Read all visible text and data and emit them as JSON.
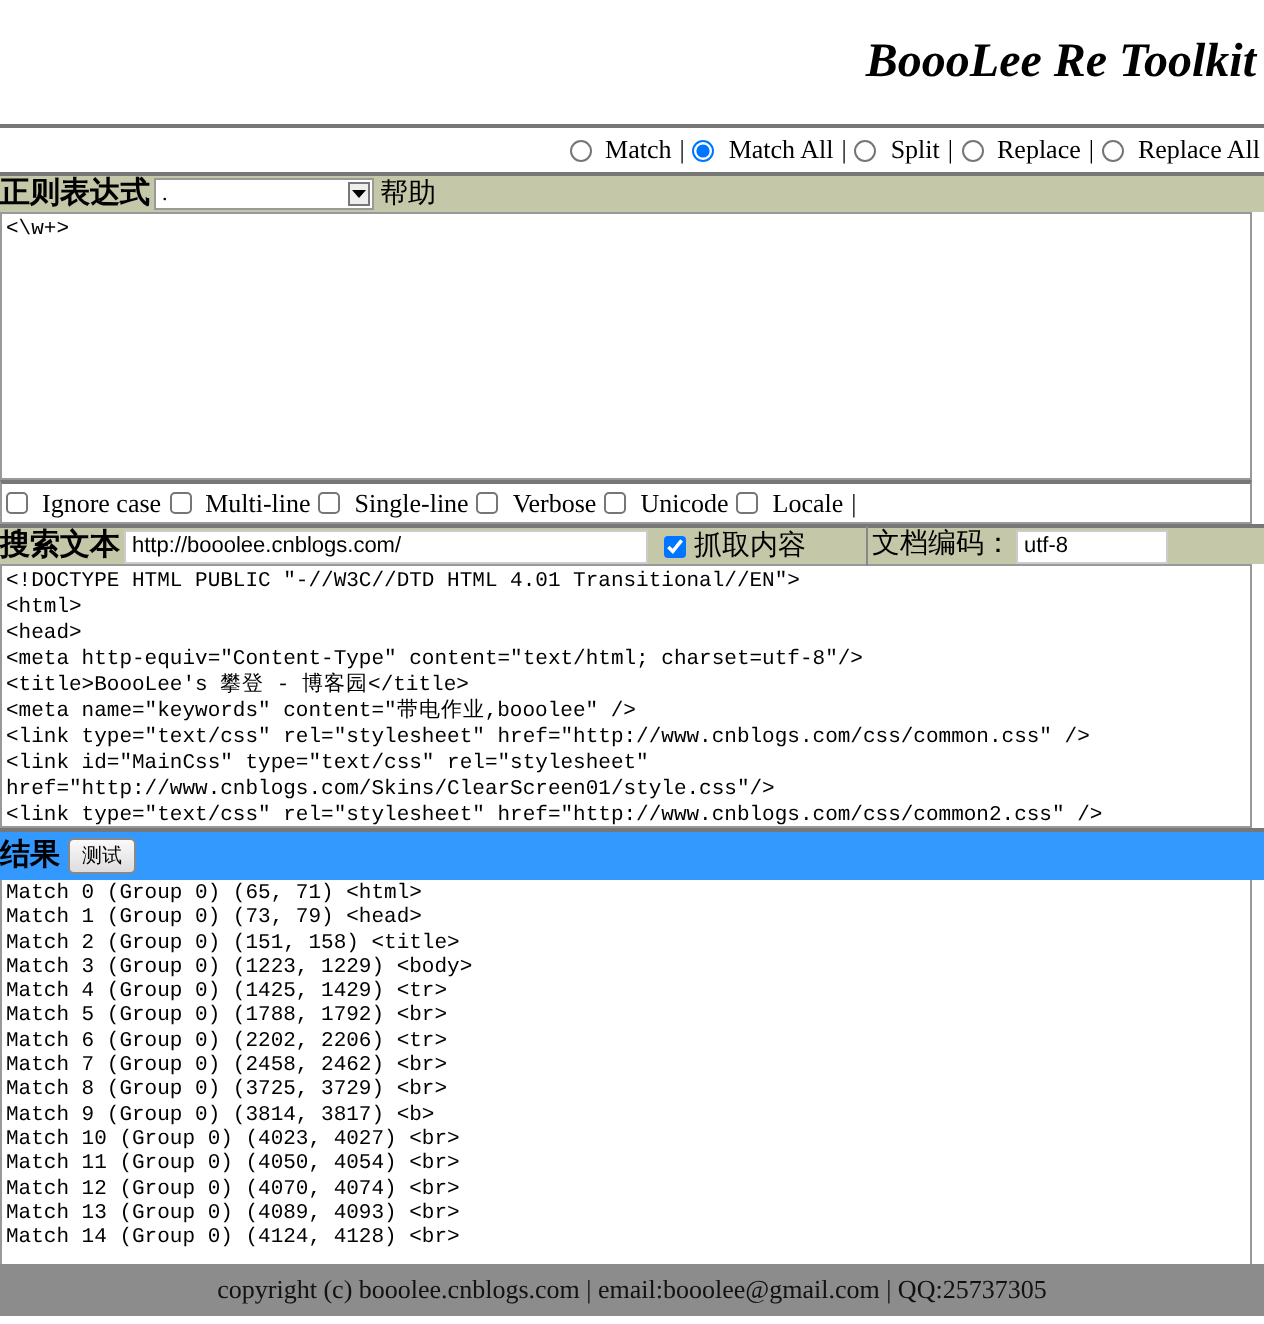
{
  "title": "BoooLee Re Toolkit",
  "modes": [
    {
      "label": "Match",
      "selected": false,
      "separator": "|"
    },
    {
      "label": "Match All",
      "selected": true,
      "separator": "|"
    },
    {
      "label": "Split",
      "selected": false,
      "separator": "|"
    },
    {
      "label": "Replace",
      "selected": false,
      "separator": "|"
    },
    {
      "label": "Replace All",
      "selected": false
    }
  ],
  "regex": {
    "label": "正则表达式",
    "value": ".",
    "help": "帮助"
  },
  "regex_text": "<\\w+>",
  "flags": [
    {
      "label": "Ignore case",
      "checked": false
    },
    {
      "label": "Multi-line",
      "checked": false
    },
    {
      "label": "Single-line",
      "checked": false
    },
    {
      "label": "Verbose",
      "checked": false
    },
    {
      "label": "Unicode",
      "checked": false
    },
    {
      "label": "Locale",
      "checked": false,
      "separator": "|"
    }
  ],
  "search": {
    "label": "搜索文本",
    "url": "http://booolee.cnblogs.com/",
    "fetch_label": "抓取内容",
    "fetch_checked": true,
    "encoding_label": "文档编码：",
    "encoding": "utf-8"
  },
  "source_lines": [
    "<!DOCTYPE HTML PUBLIC \"-//W3C//DTD HTML 4.01 Transitional//EN\">",
    "<html>",
    "<head>",
    "<meta http-equiv=\"Content-Type\" content=\"text/html; charset=utf-8\"/>",
    "<title>BoooLee's 攀登 - 博客园</title>",
    "<meta name=\"keywords\" content=\"带电作业,booolee\" />",
    "<link type=\"text/css\" rel=\"stylesheet\" href=\"http://www.cnblogs.com/css/common.css\" />",
    "<link id=\"MainCss\" type=\"text/css\" rel=\"stylesheet\"",
    "href=\"http://www.cnblogs.com/Skins/ClearScreen01/style.css\"/>",
    "<link type=\"text/css\" rel=\"stylesheet\" href=\"http://www.cnblogs.com/css/common2.css\" />"
  ],
  "results": {
    "label": "结果",
    "button": "测试"
  },
  "result_lines": [
    "Match 0 (Group 0) (65, 71) <html>",
    "Match 1 (Group 0) (73, 79) <head>",
    "Match 2 (Group 0) (151, 158) <title>",
    "Match 3 (Group 0) (1223, 1229) <body>",
    "Match 4 (Group 0) (1425, 1429) <tr>",
    "Match 5 (Group 0) (1788, 1792) <br>",
    "Match 6 (Group 0) (2202, 2206) <tr>",
    "Match 7 (Group 0) (2458, 2462) <br>",
    "Match 8 (Group 0) (3725, 3729) <br>",
    "Match 9 (Group 0) (3814, 3817) <b>",
    "Match 10 (Group 0) (4023, 4027) <br>",
    "Match 11 (Group 0) (4050, 4054) <br>",
    "Match 12 (Group 0) (4070, 4074) <br>",
    "Match 13 (Group 0) (4089, 4093) <br>",
    "Match 14 (Group 0) (4124, 4128) <br>"
  ],
  "footer": "copyright (c) booolee.cnblogs.com | email:booolee@gmail.com | QQ:25737305"
}
